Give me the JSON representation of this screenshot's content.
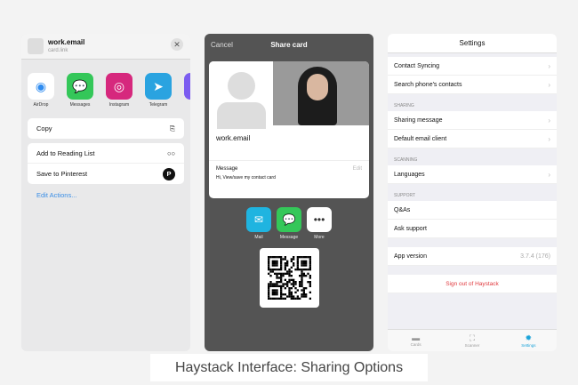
{
  "left": {
    "title": "work.email",
    "subtitle": "card.link",
    "close": "✕",
    "apps": [
      {
        "label": "AirDrop",
        "color": "#ffffff",
        "fg": "#2f8cf0",
        "glyph": "◉"
      },
      {
        "label": "Messages",
        "color": "#34c759",
        "glyph": "💬"
      },
      {
        "label": "Instagram",
        "color": "#d6287d",
        "glyph": "◎"
      },
      {
        "label": "Telegram",
        "color": "#2aa3e0",
        "glyph": "➤"
      },
      {
        "label": "",
        "color": "#7b5cf0",
        "glyph": ""
      }
    ],
    "copy": "Copy",
    "copy_icon": "⎘",
    "reading": "Add to Reading List",
    "reading_icon": "○○",
    "pinterest": "Save to Pinterest",
    "pinterest_icon": "P",
    "edit": "Edit Actions..."
  },
  "mid": {
    "cancel": "Cancel",
    "title": "Share card",
    "email": "work.email",
    "message_label": "Message",
    "edit": "Edit",
    "message": "Hi, View/save my contact card",
    "share": [
      {
        "label": "Mail",
        "glyph": "✉"
      },
      {
        "label": "Message",
        "glyph": "💬"
      },
      {
        "label": "More",
        "glyph": "•••"
      }
    ]
  },
  "right": {
    "title": "Settings",
    "contact_syncing": "Contact Syncing",
    "search_contacts": "Search phone's contacts",
    "sharing": "SHARING",
    "sharing_message": "Sharing message",
    "default_email": "Default email client",
    "scanning": "SCANNING",
    "languages": "Languages",
    "support": "SUPPORT",
    "qas": "Q&As",
    "ask_support": "Ask support",
    "app_version": "App version",
    "version": "3.7.4 (176)",
    "sign_out": "Sign out of Haystack",
    "tabs": [
      "Cards",
      "Scanner",
      "Settings"
    ],
    "accent": "#1aa3d9",
    "danger": "#e0393e"
  },
  "caption": "Haystack Interface: Sharing Options"
}
